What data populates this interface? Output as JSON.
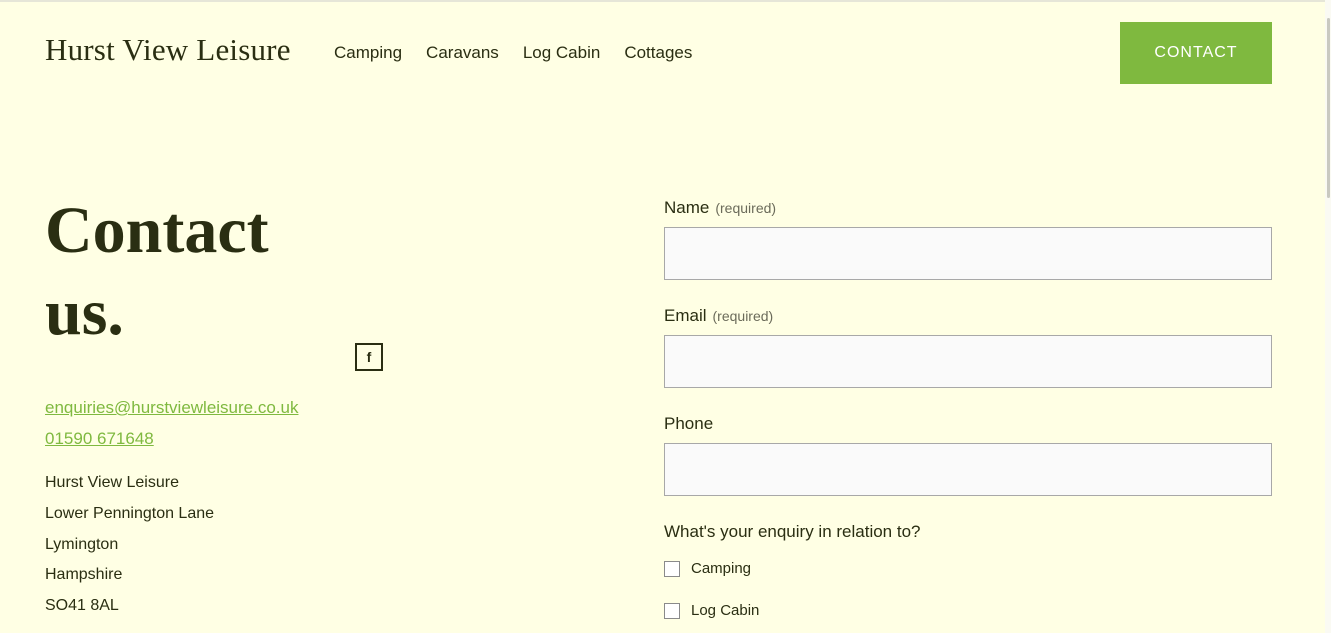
{
  "header": {
    "logo": "Hurst View Leisure",
    "nav": [
      "Camping",
      "Caravans",
      "Log Cabin",
      "Cottages"
    ],
    "contact_button": "CONTACT"
  },
  "left": {
    "headline_line1": "Contact",
    "headline_line2": "us.",
    "facebook_glyph": "f",
    "email": "enquiries@hurstviewleisure.co.uk",
    "phone": "01590 671648",
    "address": [
      "Hurst View Leisure",
      "Lower Pennington Lane",
      "Lymington",
      "Hampshire",
      "SO41 8AL"
    ]
  },
  "form": {
    "name_label": "Name",
    "email_label": "Email",
    "phone_label": "Phone",
    "required_note": "(required)",
    "enquiry_question": "What's your enquiry in relation to?",
    "options": [
      "Camping",
      "Log Cabin"
    ]
  },
  "colors": {
    "background": "#ffffe4",
    "accent": "#7fb93f",
    "text": "#2a2e12"
  },
  "icons": {
    "social": "facebook-icon"
  }
}
